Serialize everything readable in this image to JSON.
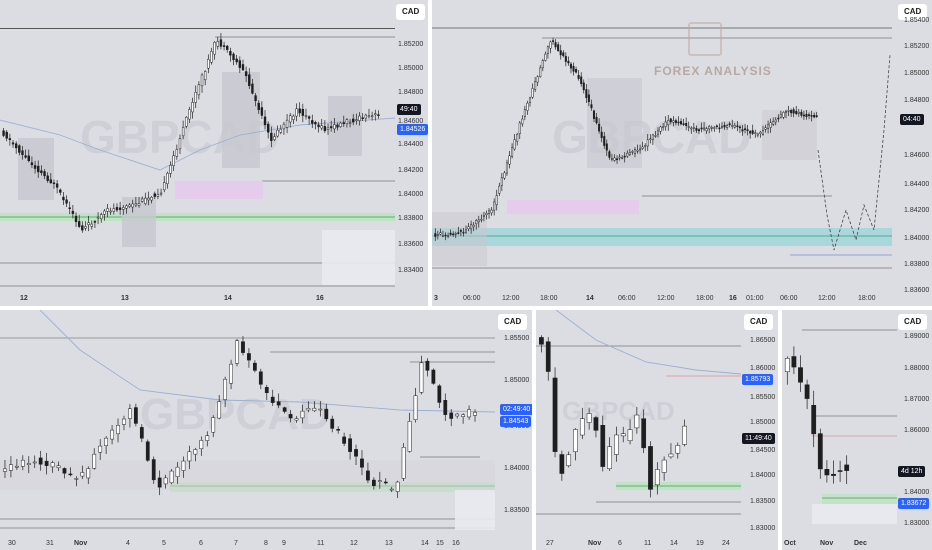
{
  "symbol": "CAD",
  "watermark": "GBPCAD",
  "branding": {
    "forex_analysis": "FOREX ANALYSIS"
  },
  "panels": {
    "p1": {
      "price_labels": [
        "1.85200",
        "1.85000",
        "1.84800",
        "1.84600",
        "1.84400",
        "1.84200",
        "1.84000",
        "1.83800",
        "1.83600",
        "1.83400"
      ],
      "countdown": "49:40",
      "current_price": "1.84526",
      "time_labels": [
        "12",
        "13",
        "14",
        "16"
      ]
    },
    "p2": {
      "price_labels": [
        "1.85400",
        "1.85200",
        "1.85000",
        "1.84800",
        "1.84600",
        "1.84400",
        "1.84200",
        "1.84000",
        "1.83800",
        "1.83600"
      ],
      "countdown": "04:40",
      "time_labels": [
        "3",
        "06:00",
        "12:00",
        "18:00",
        "14",
        "06:00",
        "12:00",
        "18:00",
        "16",
        "01:00",
        "06:00",
        "12:00",
        "18:00"
      ]
    },
    "p3": {
      "price_labels": [
        "1.85500",
        "1.85000",
        "1.84500",
        "1.84000",
        "1.83500"
      ],
      "countdown": "02:49:40",
      "current_price": "1.84543",
      "time_labels": [
        "30",
        "31",
        "Nov",
        "4",
        "5",
        "6",
        "7",
        "8",
        "9",
        "11",
        "12",
        "13",
        "14",
        "15",
        "16"
      ]
    },
    "p4": {
      "price_labels": [
        "1.86500",
        "1.86000",
        "1.85500",
        "1.85000",
        "1.84500",
        "1.84000",
        "1.83500",
        "1.83000"
      ],
      "current_price": "1.85793",
      "countdown": "11:49:40",
      "time_labels": [
        "27",
        "Nov",
        "6",
        "11",
        "14",
        "19",
        "24"
      ]
    },
    "p5": {
      "price_labels": [
        "1.89000",
        "1.88000",
        "1.87000",
        "1.86000",
        "1.84000",
        "1.83000"
      ],
      "countdown": "4d 12h",
      "current_price": "1.83672",
      "time_labels": [
        "Oct",
        "Nov",
        "Dec"
      ]
    }
  }
}
